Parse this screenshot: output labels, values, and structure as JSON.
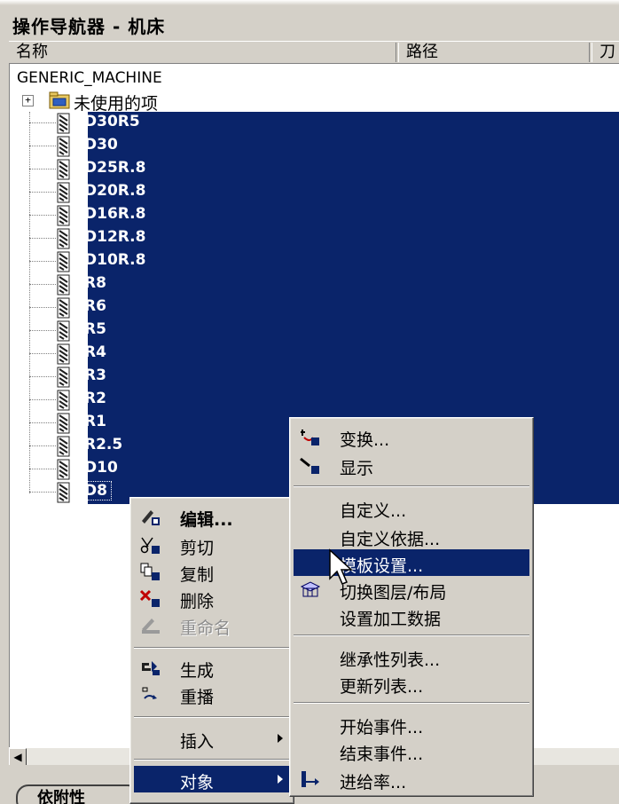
{
  "window": {
    "title": "操作导航器 - 机床"
  },
  "columns": [
    {
      "label": "名称"
    },
    {
      "label": "路径"
    },
    {
      "label": "刀"
    }
  ],
  "tree": {
    "root": "GENERIC_MACHINE",
    "unused": "未使用的项",
    "expander": "+",
    "tools": [
      "D30R5",
      "D30",
      "D25R.8",
      "D20R.8",
      "D16R.8",
      "D12R.8",
      "D10R.8",
      "R8",
      "R6",
      "R5",
      "R4",
      "R3",
      "R2",
      "R1",
      "R2.5",
      "D10",
      "D8"
    ],
    "selected_tool": "D8"
  },
  "context_menu": {
    "items": [
      {
        "label": "编辑...",
        "icon": "edit-icon",
        "bold": true
      },
      {
        "label": "剪切",
        "icon": "cut-icon"
      },
      {
        "label": "复制",
        "icon": "copy-icon"
      },
      {
        "label": "删除",
        "icon": "delete-icon"
      },
      {
        "label": "重命名",
        "icon": "rename-icon",
        "disabled": true
      },
      {
        "label": "生成",
        "icon": "generate-icon"
      },
      {
        "label": "重播",
        "icon": "replay-icon"
      },
      {
        "label": "插入",
        "submenu": true
      },
      {
        "label": "对象",
        "submenu": true,
        "highlighted": true
      }
    ]
  },
  "submenu": {
    "items": [
      {
        "label": "变换...",
        "icon": "transform-icon"
      },
      {
        "label": "显示",
        "icon": "display-icon"
      },
      {
        "label": "自定义..."
      },
      {
        "label": "自定义依据..."
      },
      {
        "label": "模板设置...",
        "highlighted": true
      },
      {
        "label": "切换图层/布局",
        "icon": "layer-layout-icon"
      },
      {
        "label": "设置加工数据"
      },
      {
        "label": "继承性列表..."
      },
      {
        "label": "更新列表..."
      },
      {
        "label": "开始事件..."
      },
      {
        "label": "结束事件..."
      },
      {
        "label": "进给率...",
        "icon": "feedrate-icon"
      }
    ]
  },
  "bottom": {
    "button_label": "依附性"
  },
  "colors": {
    "selection": "#0a246a",
    "menu_bg": "#d4d0c8",
    "tree_bg": "#ffffff"
  }
}
